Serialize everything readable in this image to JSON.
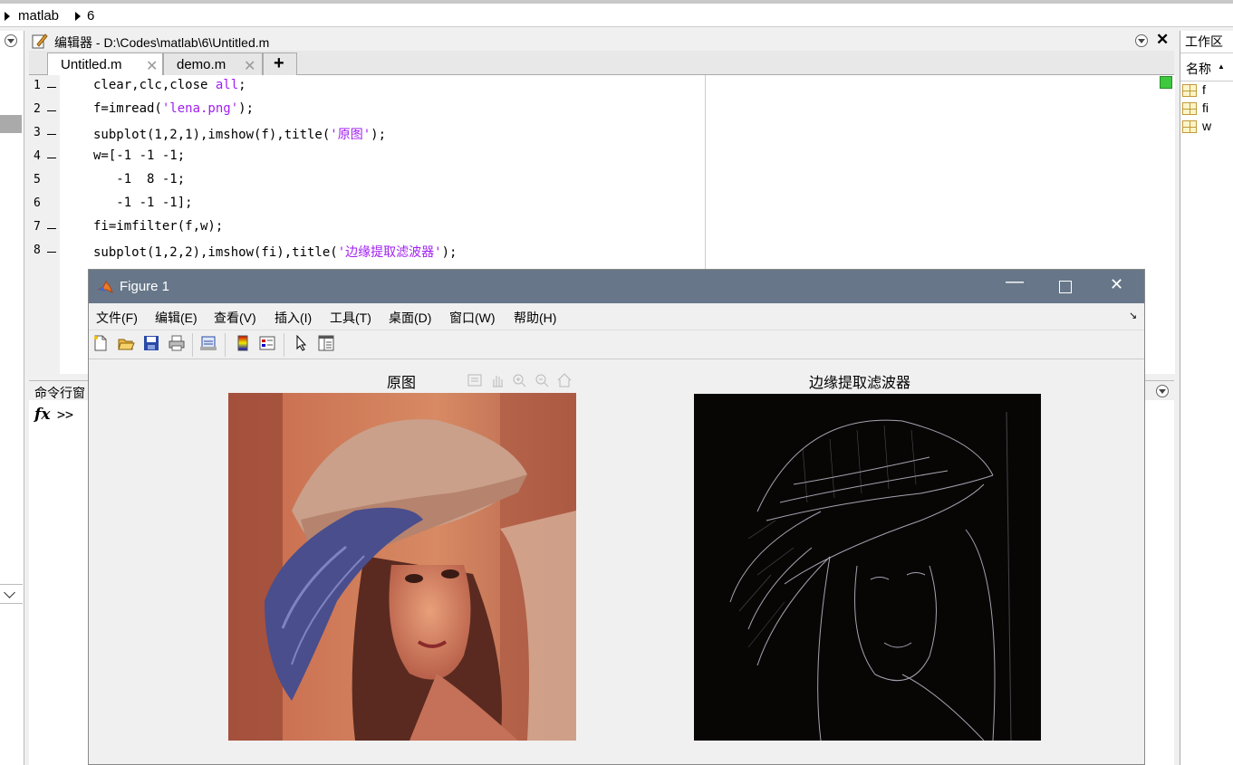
{
  "breadcrumb": [
    "matlab",
    "6"
  ],
  "editor": {
    "title": "编辑器 - D:\\Codes\\matlab\\6\\Untitled.m",
    "tabs": [
      {
        "label": "Untitled.m",
        "active": true
      },
      {
        "label": "demo.m",
        "active": false
      }
    ],
    "add_tab": "+",
    "lines": [
      {
        "num": "1",
        "dash": true,
        "parts": [
          {
            "t": "clear,clc,close "
          },
          {
            "t": "all",
            "s": true
          },
          {
            "t": ";"
          }
        ]
      },
      {
        "num": "2",
        "dash": true,
        "parts": [
          {
            "t": "f=imread("
          },
          {
            "t": "'lena.png'",
            "s": true
          },
          {
            "t": ");"
          }
        ]
      },
      {
        "num": "3",
        "dash": true,
        "parts": [
          {
            "t": "subplot(1,2,1),imshow(f),title("
          },
          {
            "t": "'原图'",
            "s": true
          },
          {
            "t": ");"
          }
        ]
      },
      {
        "num": "4",
        "dash": true,
        "parts": [
          {
            "t": "w=[-1 -1 -1;"
          }
        ]
      },
      {
        "num": "5",
        "dash": false,
        "parts": [
          {
            "t": "   -1  8 -1;"
          }
        ]
      },
      {
        "num": "6",
        "dash": false,
        "parts": [
          {
            "t": "   -1 -1 -1];"
          }
        ]
      },
      {
        "num": "7",
        "dash": true,
        "parts": [
          {
            "t": "fi=imfilter(f,w);"
          }
        ]
      },
      {
        "num": "8",
        "dash": true,
        "parts": [
          {
            "t": "subplot(1,2,2),imshow(fi),title("
          },
          {
            "t": "'边缘提取滤波器'",
            "s": true
          },
          {
            "t": ");"
          }
        ]
      }
    ]
  },
  "command_window": {
    "title": "命令行窗",
    "fx": "fx",
    "prompt": ">>"
  },
  "workspace": {
    "title": "工作区",
    "column": "名称",
    "vars": [
      "f",
      "fi",
      "w"
    ]
  },
  "figure": {
    "title": "Figure 1",
    "menus": [
      "文件(F)",
      "编辑(E)",
      "查看(V)",
      "插入(I)",
      "工具(T)",
      "桌面(D)",
      "窗口(W)",
      "帮助(H)"
    ],
    "left_title": "原图",
    "right_title": "边缘提取滤波器"
  },
  "colors": {
    "figure_titlebar": "#677789",
    "string_purple": "#a020f0"
  }
}
